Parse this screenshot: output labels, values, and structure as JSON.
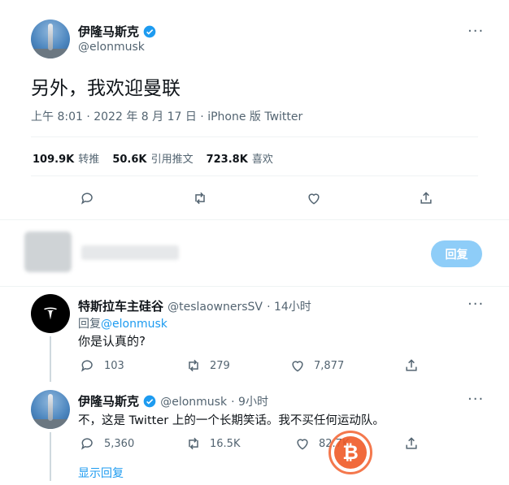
{
  "main_tweet": {
    "author_name": "伊隆马斯克",
    "author_handle": "@elonmusk",
    "text": "另外，我欢迎曼联",
    "meta": "上午 8:01 · 2022 年 8 月 17 日 · iPhone 版 Twitter",
    "stats": {
      "retweets_num": "109.9K",
      "retweets_label": "转推",
      "quotes_num": "50.6K",
      "quotes_label": "引用推文",
      "likes_num": "723.8K",
      "likes_label": "喜欢"
    }
  },
  "compose": {
    "reply_button": "回复"
  },
  "reply1": {
    "author_name": "特斯拉车主硅谷",
    "author_handle": "@teslaownersSV",
    "time": "· 14小时",
    "replying_prefix": "回复",
    "replying_to": "@elonmusk",
    "text": "你是认真的?",
    "replies": "103",
    "retweets": "279",
    "likes": "7,877"
  },
  "reply2": {
    "author_name": "伊隆马斯克",
    "author_handle": "@elonmusk",
    "time": "· 9小时",
    "text": "不，这是 Twitter 上的一个长期笑话。我不买任何运动队。",
    "replies": "5,360",
    "retweets": "16.5K",
    "likes": "82.7K"
  },
  "show_replies": "显示回复",
  "colors": {
    "accent": "#1d9bf0",
    "verified": "#1d9bf0",
    "watermark": "#f05a28"
  },
  "icons": [
    "verified-badge-icon",
    "more-icon",
    "reply-icon",
    "retweet-icon",
    "like-icon",
    "share-icon",
    "bitcoin-icon"
  ]
}
